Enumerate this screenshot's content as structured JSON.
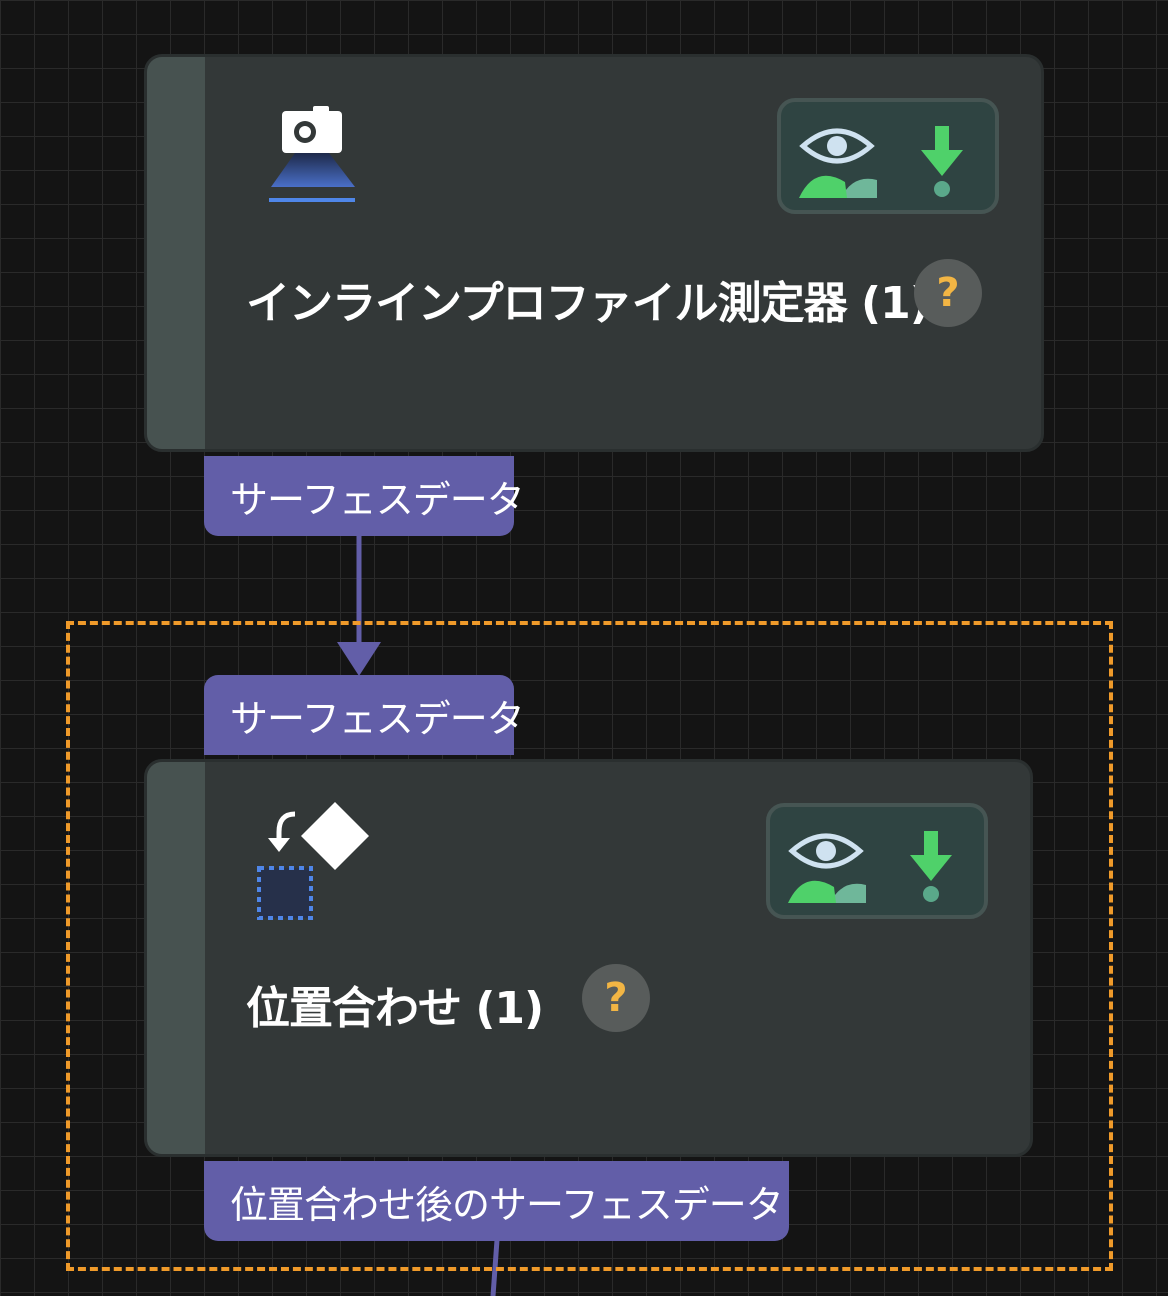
{
  "nodes": [
    {
      "title": "インラインプロファイル測定器 (1)",
      "icon": "camera-projector-icon",
      "help_symbol": "?",
      "output_port": "サーフェスデータ"
    },
    {
      "title": "位置合わせ (1)",
      "icon": "alignment-icon",
      "help_symbol": "?",
      "input_port": "サーフェスデータ",
      "output_port": "位置合わせ後のサーフェスデータ"
    }
  ],
  "status_icons": [
    "view-eye-icon",
    "download-arrow-icon"
  ],
  "colors": {
    "node_bg": "#333838",
    "port_bg": "#625ea8",
    "selection_border": "#ef9a2a",
    "accent_green": "#4fd16a",
    "help_question": "#f2b544"
  }
}
